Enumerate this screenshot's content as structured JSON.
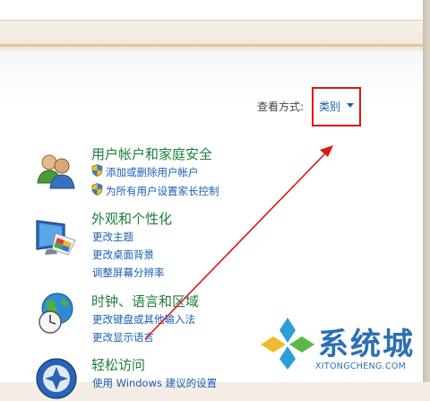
{
  "toolbar": {
    "view_by_label": "查看方式:",
    "view_by_value": "类别"
  },
  "categories": [
    {
      "title": "用户帐户和家庭安全",
      "links": [
        "添加或删除用户帐户",
        "为所有用户设置家长控制"
      ],
      "icon": "users-icon"
    },
    {
      "title": "外观和个性化",
      "links": [
        "更改主题",
        "更改桌面背景",
        "调整屏幕分辨率"
      ],
      "icon": "monitor-paint-icon"
    },
    {
      "title": "时钟、语言和区域",
      "links": [
        "更改键盘或其他输入法",
        "更改显示语言"
      ],
      "icon": "globe-clock-icon"
    },
    {
      "title": "轻松访问",
      "links": [
        "使用 Windows 建议的设置"
      ],
      "icon": "accessibility-icon"
    }
  ],
  "watermark": {
    "text": "系统城",
    "url": "XITONGCHENG.COM"
  },
  "colors": {
    "category_title": "#1c7e3a",
    "link": "#1a5fb4",
    "annotation_red": "#e01313"
  }
}
